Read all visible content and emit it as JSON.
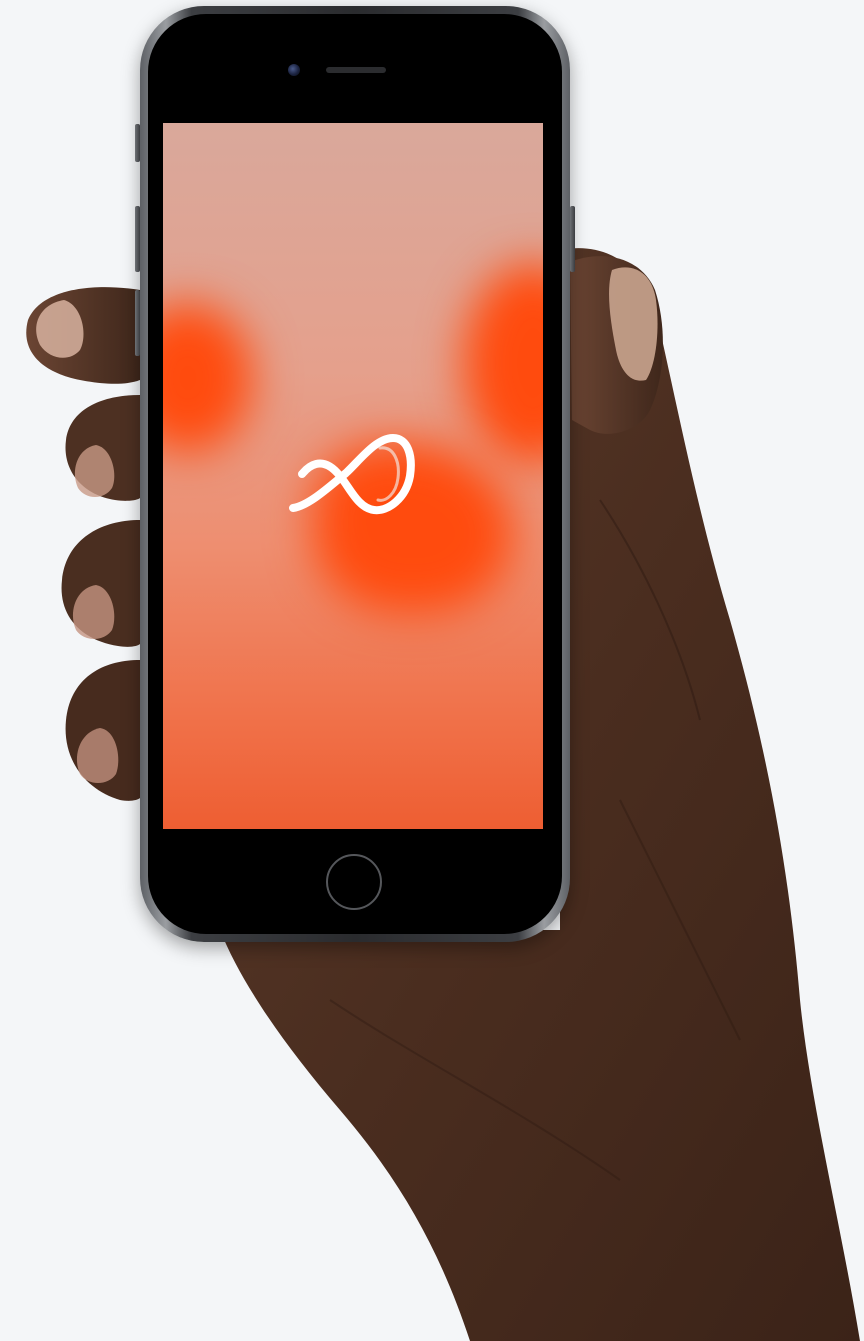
{
  "scene": {
    "description_colors": {
      "background": "#f4f6f8",
      "phone_frame": "#2a2b2e",
      "screen_accent": "#ff4b0e",
      "logo": "#ffffff"
    }
  },
  "app": {
    "splash_logo_icon": "infinity-ribbon-logo-icon"
  },
  "device": {
    "home_button_icon": "home-button-icon"
  }
}
